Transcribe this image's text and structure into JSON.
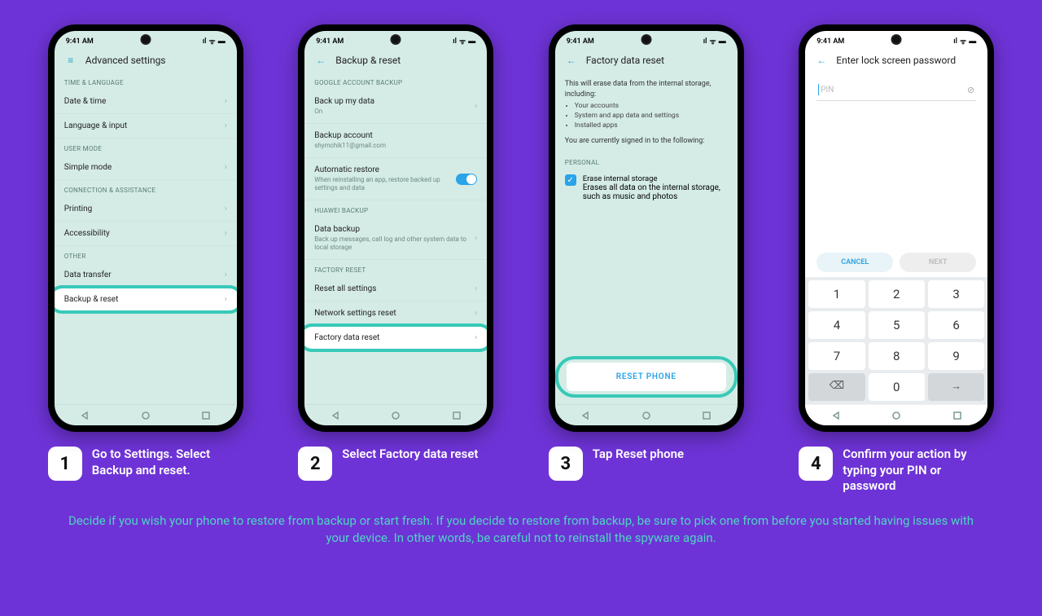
{
  "status": {
    "time": "9:41 AM",
    "sig": "••ıl",
    "wifi": "⨳",
    "batt": "▮"
  },
  "phone1": {
    "title": "Advanced settings",
    "sec1": "TIME & LANGUAGE",
    "r1": "Date & time",
    "r2": "Language & input",
    "sec2": "USER MODE",
    "r3": "Simple mode",
    "sec3": "CONNECTION & ASSISTANCE",
    "r4": "Printing",
    "r5": "Accessibility",
    "sec4": "OTHER",
    "r6": "Data transfer",
    "r7": "Backup & reset"
  },
  "phone2": {
    "title": "Backup & reset",
    "sec1": "GOOGLE ACCOUNT BACKUP",
    "r1": "Back up my data",
    "r1s": "On",
    "r2": "Backup account",
    "r2s": "shymchik11@gmail.com",
    "r3": "Automatic restore",
    "r3s": "When reinstalling an app, restore backed up settings and data",
    "sec2": "HUAWEI BACKUP",
    "r4": "Data backup",
    "r4s": "Back up messages, call log and other system data to local storage",
    "sec3": "FACTORY RESET",
    "r5": "Reset all settings",
    "r6": "Network settings reset",
    "r7": "Factory data reset"
  },
  "phone3": {
    "title": "Factory data reset",
    "intro": "This will erase data from the internal storage, including:",
    "b1": "Your accounts",
    "b2": "System and app data and settings",
    "b3": "Installed apps",
    "signed": "You are currently signed in to the following:",
    "sec": "PERSONAL",
    "chk": "Erase internal storage",
    "chks": "Erases all data on the internal storage, such as music and photos",
    "btn": "RESET PHONE"
  },
  "phone4": {
    "title": "Enter lock screen password",
    "ph": "PIN",
    "cancel": "CANCEL",
    "next": "NEXT",
    "keys": [
      "1",
      "2",
      "3",
      "4",
      "5",
      "6",
      "7",
      "8",
      "9"
    ],
    "k0": "0"
  },
  "steps": {
    "n1": "1",
    "t1": "Go to Settings. Select Backup and reset.",
    "n2": "2",
    "t2": "Select Factory data reset",
    "n3": "3",
    "t3": "Tap Reset phone",
    "n4": "4",
    "t4": "Confirm your action by typing your PIN or password"
  },
  "footer": "Decide if you wish your phone to restore from backup or start fresh. If you decide to restore from backup, be sure to pick one from before you started having issues with your device. In other words, be careful not to reinstall the spyware again."
}
